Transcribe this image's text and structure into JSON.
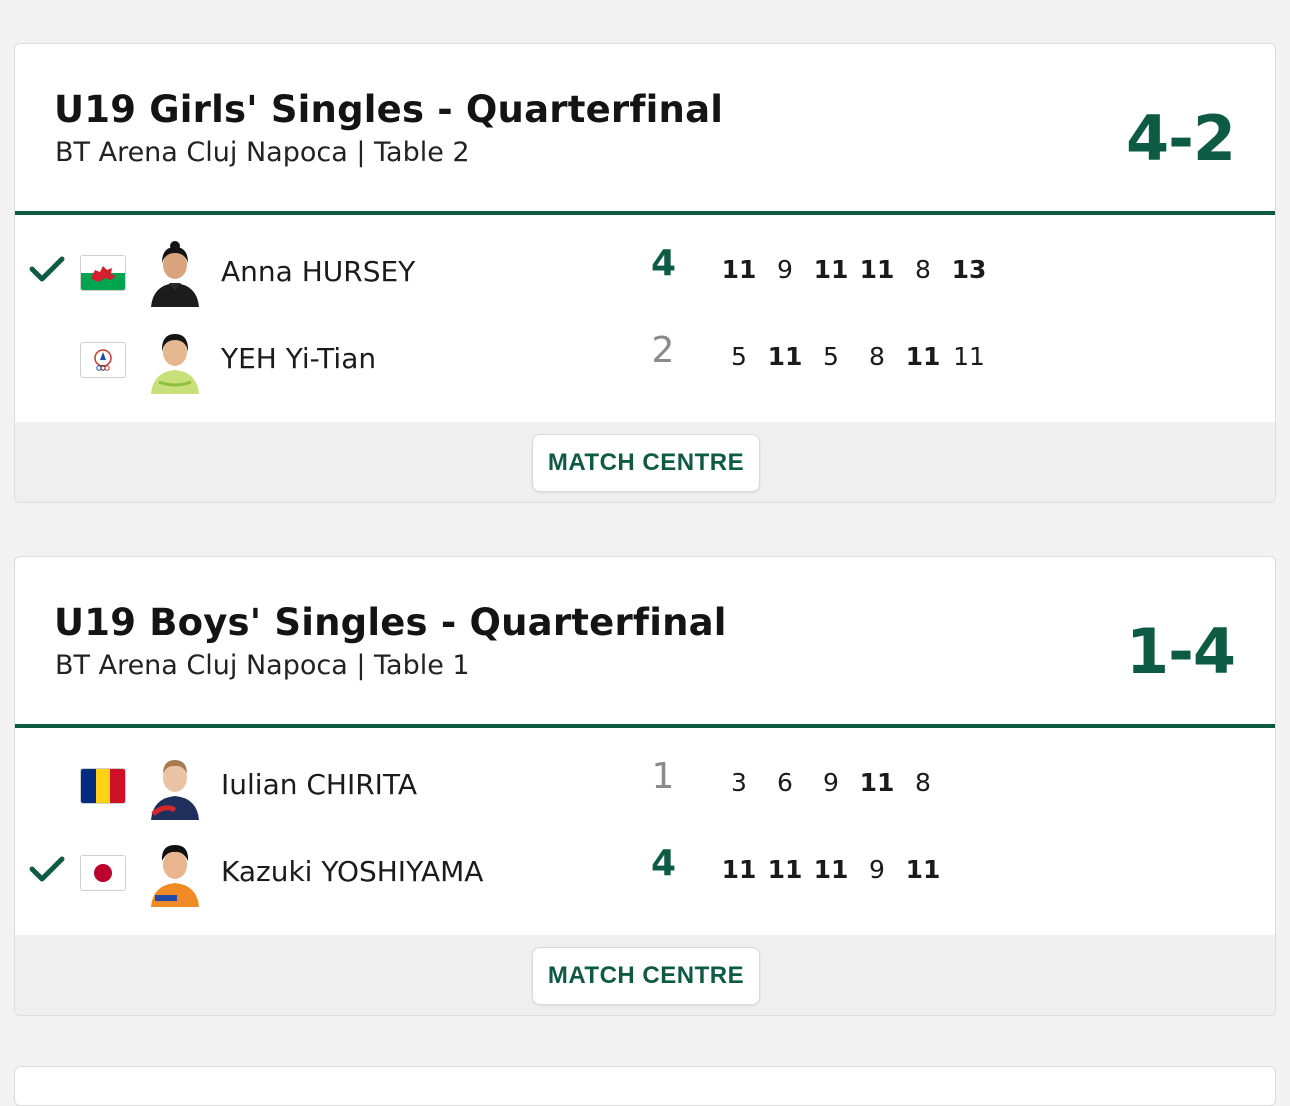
{
  "matches": [
    {
      "title": "U19 Girls' Singles - Quarterfinal",
      "venue": "BT Arena Cluj Napoca | Table 2",
      "score": "4-2",
      "button": "MATCH CENTRE",
      "players": [
        {
          "name": "Anna HURSEY",
          "country_flag": "wales-flag",
          "winner": true,
          "games": "4",
          "sets": [
            {
              "v": "11",
              "w": true
            },
            {
              "v": "9",
              "w": false
            },
            {
              "v": "11",
              "w": true
            },
            {
              "v": "11",
              "w": true
            },
            {
              "v": "8",
              "w": false
            },
            {
              "v": "13",
              "w": true
            }
          ]
        },
        {
          "name": "YEH Yi-Tian",
          "country_flag": "chinese-taipei-flag",
          "winner": false,
          "games": "2",
          "sets": [
            {
              "v": "5",
              "w": false
            },
            {
              "v": "11",
              "w": true
            },
            {
              "v": "5",
              "w": false
            },
            {
              "v": "8",
              "w": false
            },
            {
              "v": "11",
              "w": true
            },
            {
              "v": "11",
              "w": false
            }
          ]
        }
      ]
    },
    {
      "title": "U19 Boys' Singles - Quarterfinal",
      "venue": "BT Arena Cluj Napoca | Table 1",
      "score": "1-4",
      "button": "MATCH CENTRE",
      "players": [
        {
          "name": "Iulian CHIRITA",
          "country_flag": "romania-flag",
          "winner": false,
          "games": "1",
          "sets": [
            {
              "v": "3",
              "w": false
            },
            {
              "v": "6",
              "w": false
            },
            {
              "v": "9",
              "w": false
            },
            {
              "v": "11",
              "w": true
            },
            {
              "v": "8",
              "w": false
            }
          ]
        },
        {
          "name": "Kazuki YOSHIYAMA",
          "country_flag": "japan-flag",
          "winner": true,
          "games": "4",
          "sets": [
            {
              "v": "11",
              "w": true
            },
            {
              "v": "11",
              "w": true
            },
            {
              "v": "11",
              "w": true
            },
            {
              "v": "9",
              "w": false
            },
            {
              "v": "11",
              "w": true
            }
          ]
        }
      ]
    }
  ],
  "colors": {
    "accent": "#0e5b43",
    "footer_bg": "#efefef",
    "page_bg": "#f2f2f2"
  },
  "icons": {
    "winner": "checkmark-icon"
  }
}
